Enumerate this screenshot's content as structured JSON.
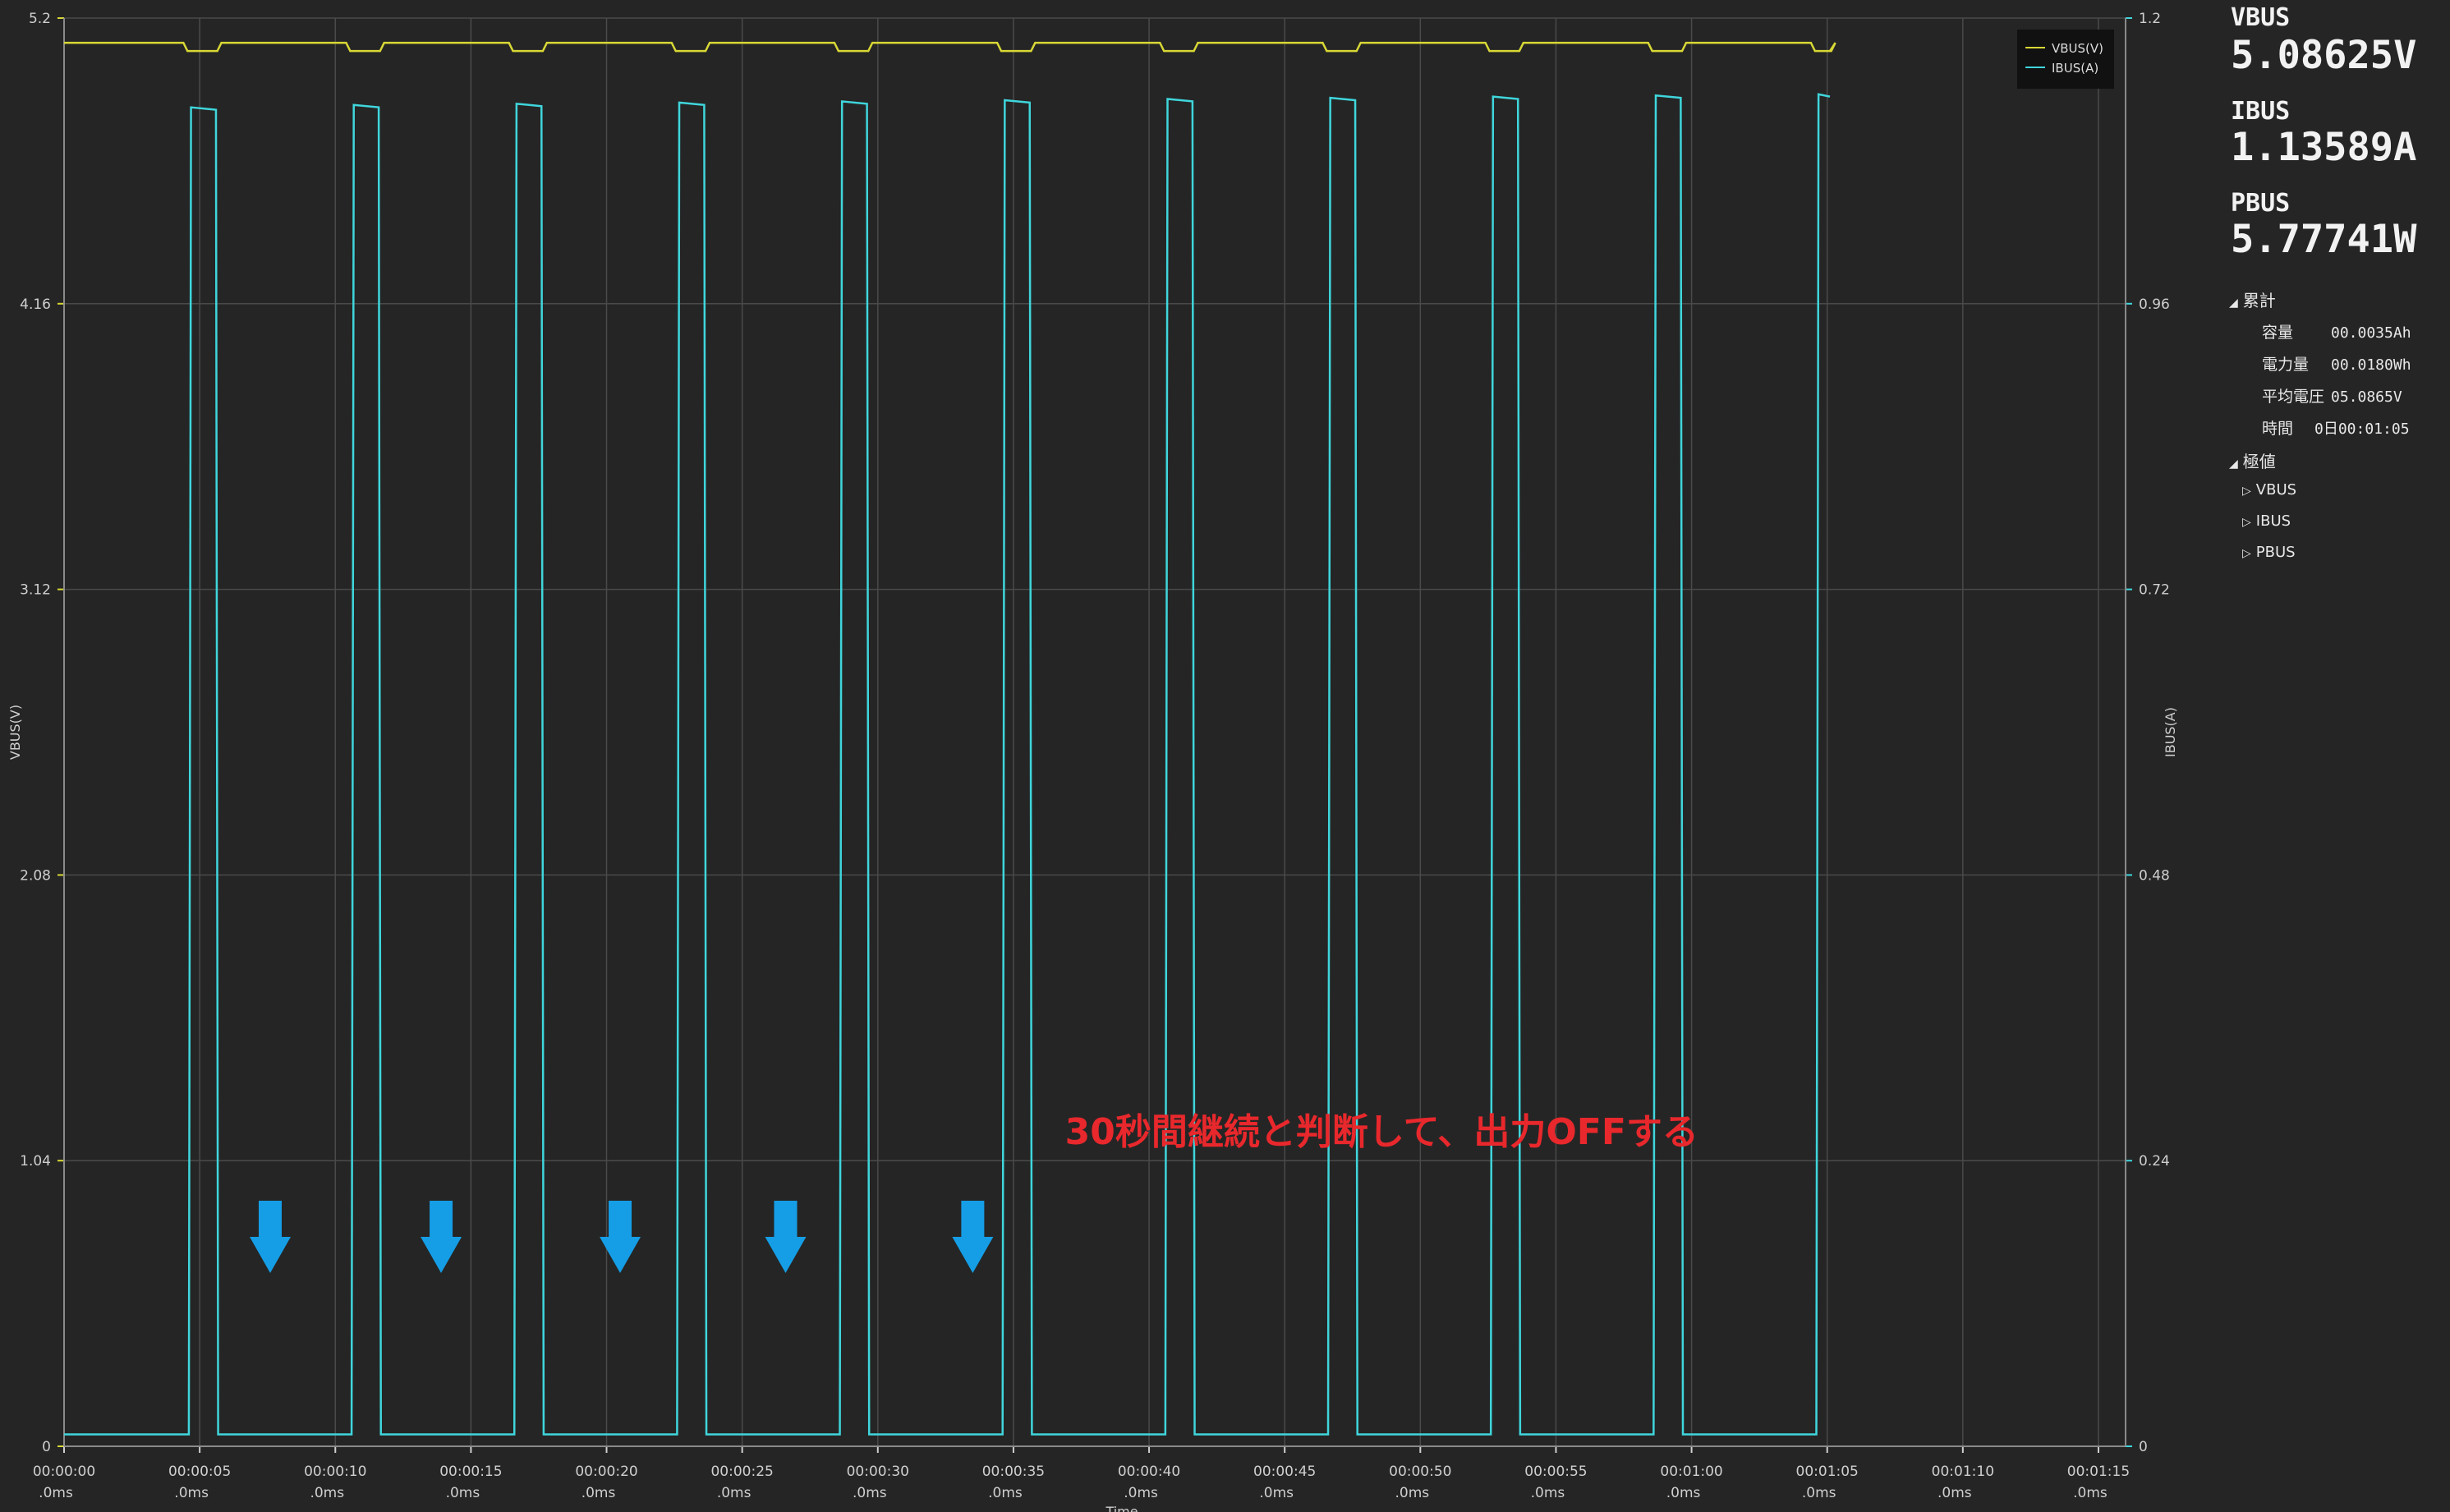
{
  "readouts": {
    "vbus": {
      "label": "VBUS",
      "value": "5.08625V"
    },
    "ibus": {
      "label": "IBUS",
      "value": "1.13589A"
    },
    "pbus": {
      "label": "PBUS",
      "value": "5.77741W"
    }
  },
  "stats": {
    "cumulative_label": "累計",
    "rows": [
      {
        "key": "容量",
        "value": "00.0035Ah"
      },
      {
        "key": "電力量",
        "value": "00.0180Wh"
      },
      {
        "key": "平均電圧",
        "value": "05.0865V"
      },
      {
        "key": "時間",
        "value": "0日00:01:05"
      }
    ],
    "extremes_label": "極値",
    "extremes": [
      "VBUS",
      "IBUS",
      "PBUS"
    ]
  },
  "colors": {
    "background": "#252525",
    "grid": "#4a4a4a",
    "vbus": "#d8d836",
    "ibus": "#3fd6dc",
    "annotation": "#e8282c",
    "arrow": "#159ee6"
  },
  "chart_data": {
    "type": "line",
    "xlabel": "Time",
    "ylabel_left": "VBUS(V)",
    "ylabel_right": "IBUS(A)",
    "ylim_left": [
      0,
      5.2
    ],
    "ylim_right": [
      0,
      1.2
    ],
    "yticks_left": [
      "0",
      "1.04",
      "2.08",
      "3.12",
      "4.16",
      "5.2"
    ],
    "yticks_right": [
      "0",
      "0.24",
      "0.48",
      "0.72",
      "0.96",
      "1.2"
    ],
    "xlim_seconds": [
      0,
      76
    ],
    "xtick_seconds": [
      0,
      5,
      10,
      15,
      20,
      25,
      30,
      35,
      40,
      45,
      50,
      55,
      60,
      65,
      70,
      75
    ],
    "xtick_labels": [
      "00:00:00",
      "00:00:05",
      "00:00:10",
      "00:00:15",
      "00:00:20",
      "00:00:25",
      "00:00:30",
      "00:00:35",
      "00:00:40",
      "00:00:45",
      "00:00:50",
      "00:00:55",
      "00:01:00",
      "00:01:05",
      "00:01:10",
      "00:01:15"
    ],
    "xtick_sublabel": ".0ms",
    "legend": [
      "VBUS(V)",
      "IBUS(A)"
    ],
    "legend_position": "top-right",
    "grid": true,
    "series": [
      {
        "name": "VBUS(V)",
        "axis": "left",
        "baseline": 5.11,
        "dip": 5.08,
        "x": [
          0,
          65.1
        ]
      },
      {
        "name": "IBUS(A)",
        "axis": "right",
        "low": 0.01,
        "pulses": [
          {
            "start": 4.6,
            "end": 5.6,
            "high": 1.125
          },
          {
            "start": 10.6,
            "end": 11.6,
            "high": 1.127
          },
          {
            "start": 16.6,
            "end": 17.6,
            "high": 1.128
          },
          {
            "start": 22.6,
            "end": 23.6,
            "high": 1.129
          },
          {
            "start": 28.6,
            "end": 29.6,
            "high": 1.13
          },
          {
            "start": 34.6,
            "end": 35.6,
            "high": 1.131
          },
          {
            "start": 40.6,
            "end": 41.6,
            "high": 1.132
          },
          {
            "start": 46.6,
            "end": 47.6,
            "high": 1.133
          },
          {
            "start": 52.6,
            "end": 53.6,
            "high": 1.134
          },
          {
            "start": 58.6,
            "end": 59.6,
            "high": 1.135
          },
          {
            "start": 64.6,
            "end": 65.1,
            "high": 1.136
          }
        ]
      }
    ],
    "annotation": {
      "text": "30秒間継続と判断して、出力OFFする",
      "x": 36.9,
      "y_left": 1.1
    },
    "arrows_x_seconds": [
      7.6,
      13.9,
      20.5,
      26.6,
      33.5
    ]
  }
}
